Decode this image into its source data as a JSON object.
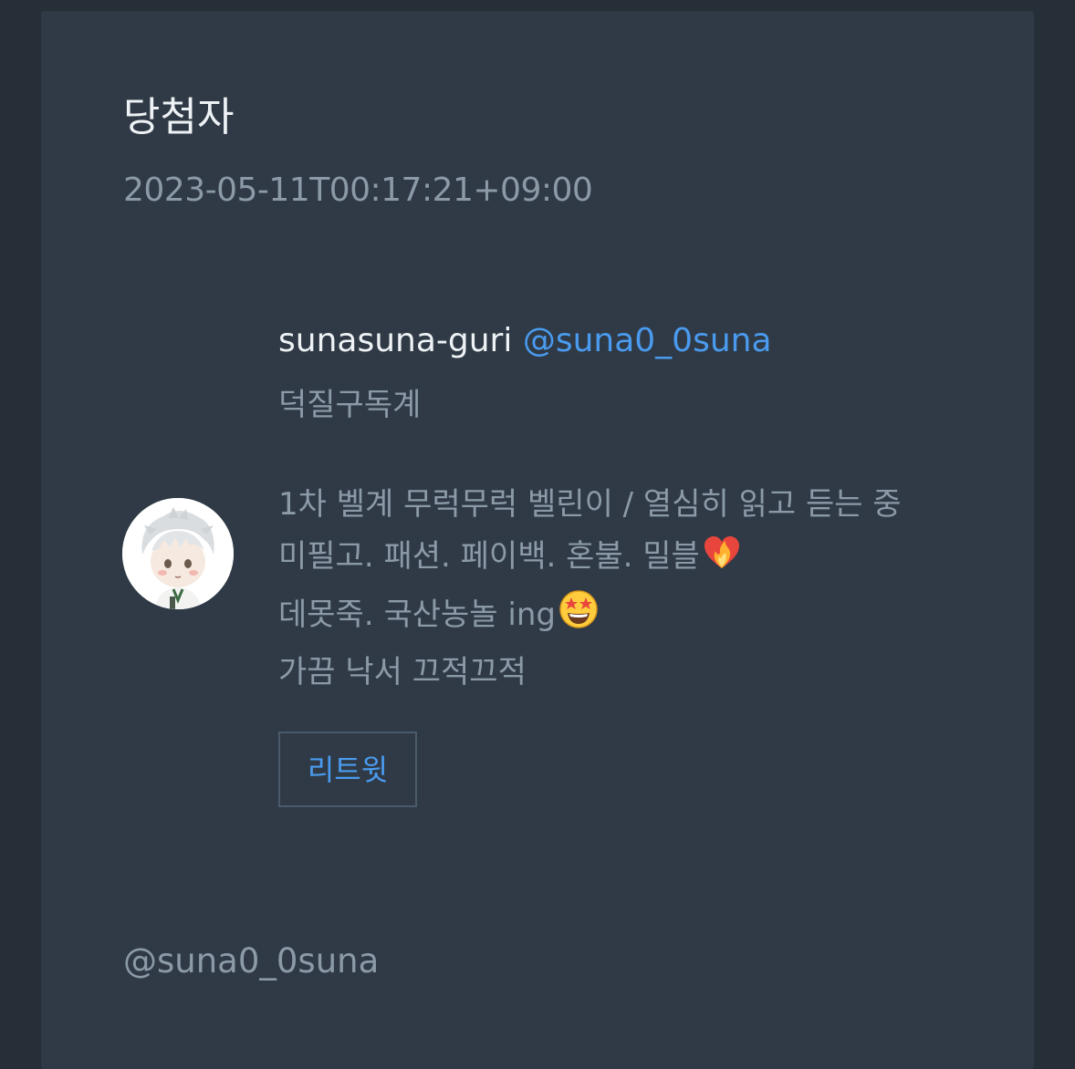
{
  "post": {
    "title": "당첨자",
    "timestamp": "2023-05-11T00:17:21+09:00"
  },
  "profile": {
    "display_name": "sunasuna-guri",
    "handle": "@suna0_0suna",
    "subtitle": "덕질구독계",
    "bio_lines": [
      "1차 벨계 무럭무럭 벨린이 / 열심히 읽고 듣는 중",
      "미필고. 패션. 페이백. 혼불. 밀블",
      "데못죽. 국산농놀 ing",
      "가끔 낙서 끄적끄적"
    ],
    "bio_emojis": [
      "heart-on-fire-icon",
      "star-struck-face-icon"
    ],
    "retweet_label": "리트윗"
  },
  "footer": {
    "handle": "@suna0_0suna"
  },
  "colors": {
    "background": "#262f38",
    "card": "#2f3a46",
    "accent": "#4a9bef",
    "muted_text": "#8c9aa8"
  }
}
